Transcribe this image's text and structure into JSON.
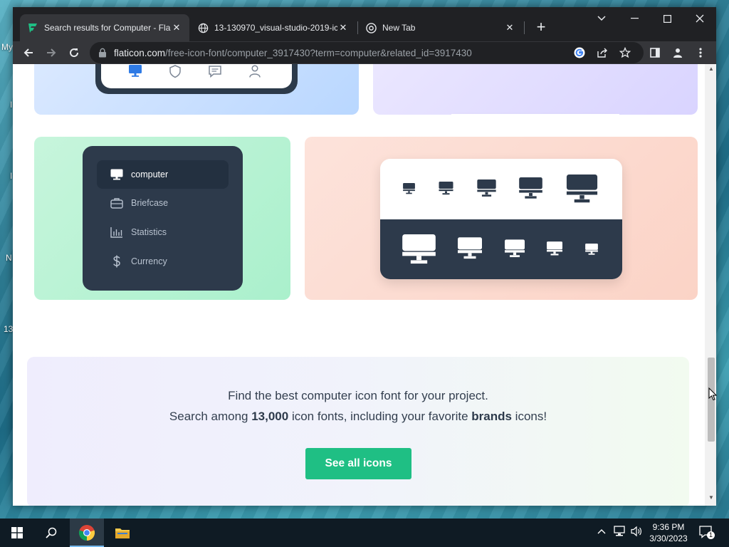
{
  "browser": {
    "tabs": [
      {
        "title": "Search results for Computer - Fla",
        "favicon": "flaticon-logo-icon",
        "active": true
      },
      {
        "title": "13-130970_visual-studio-2019-ic",
        "favicon": "globe-icon",
        "active": false
      },
      {
        "title": "New Tab",
        "favicon": "chrome-icon",
        "active": false
      }
    ],
    "url": {
      "domain": "flaticon.com",
      "path": "/free-icon-font/computer_3917430?term=computer&related_id=3917430"
    }
  },
  "desktop": {
    "fragments": [
      "My",
      "I",
      "I",
      "N",
      "13"
    ]
  },
  "page": {
    "menu_items": [
      {
        "label": "computer",
        "icon": "monitor-icon",
        "selected": true
      },
      {
        "label": "Briefcase",
        "icon": "briefcase-icon",
        "selected": false
      },
      {
        "label": "Statistics",
        "icon": "chart-icon",
        "selected": false
      },
      {
        "label": "Currency",
        "icon": "dollar-icon",
        "selected": false
      }
    ],
    "cta": {
      "line1": "Find the best computer icon font for your project.",
      "line2_prefix": "Search among ",
      "line2_count": "13,000",
      "line2_middle": " icon fonts, including your favorite ",
      "line2_brands": "brands",
      "line2_suffix": " icons!",
      "button_label": "See all icons"
    },
    "colors": {
      "accent_green": "#1fbf84",
      "panel_dark": "#2d3a4b"
    }
  },
  "taskbar": {
    "time": "9:36 PM",
    "date": "3/30/2023",
    "notification_count": "1"
  }
}
